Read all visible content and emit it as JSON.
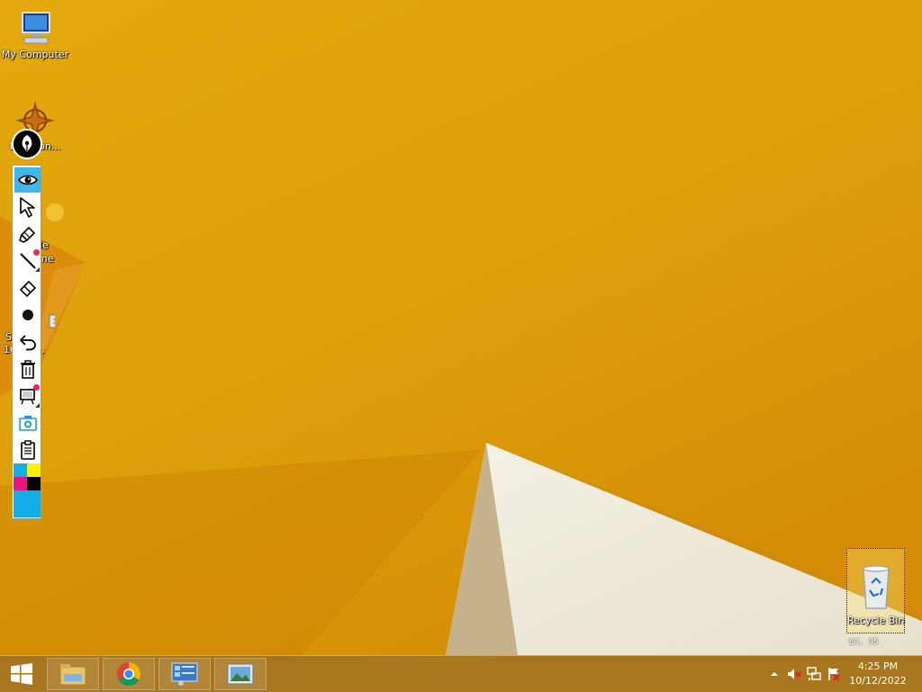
{
  "desktop": {
    "icons": [
      {
        "label": "My Computer",
        "icon": "computer-icon"
      },
      {
        "label": "Dark Dragon...",
        "visible_label": "Da  agon...",
        "icon": "dragon-icon"
      },
      {
        "label": "le\nme",
        "line1": "le",
        "line2": "me",
        "icon": "chrome-shortcut-icon"
      },
      {
        "label": "Shot",
        "line1": "S      Shot",
        "line2": "10   22 ...",
        "icon": "screenshot-file-icon"
      }
    ],
    "recycle_bin": {
      "label": "Recycle Bin",
      "icon": "recycle-bin-icon"
    },
    "cursor_readout": "64, 95"
  },
  "pen_toolbar": {
    "logo": "pen-nib-icon",
    "tools": [
      {
        "name": "view-tool",
        "icon": "eye-icon",
        "active": true
      },
      {
        "name": "select-tool",
        "icon": "arrow-cursor-icon"
      },
      {
        "name": "highlighter-tool",
        "icon": "highlighter-icon",
        "badge": true
      },
      {
        "name": "line-tool",
        "icon": "line-icon",
        "menu": true
      },
      {
        "name": "eraser-tool",
        "icon": "eraser-icon"
      },
      {
        "name": "pen-size-tool",
        "icon": "dot-icon"
      },
      {
        "name": "undo-tool",
        "icon": "undo-icon"
      },
      {
        "name": "delete-tool",
        "icon": "trash-icon"
      },
      {
        "name": "whiteboard-tool",
        "icon": "whiteboard-icon",
        "badge": true,
        "menu": true
      },
      {
        "name": "screenshot-tool",
        "icon": "camera-icon"
      },
      {
        "name": "clipboard-tool",
        "icon": "clipboard-icon"
      }
    ],
    "colors": {
      "cyan": "#12aee8",
      "yellow": "#fff200",
      "magenta": "#e8157f",
      "black": "#000000",
      "selected": "#12aee8"
    },
    "badge_color": "#e8265e",
    "active_color": "#3db8e8"
  },
  "taskbar": {
    "start": "windows-logo-icon",
    "pinned": [
      {
        "name": "file-explorer",
        "icon": "folder-icon"
      },
      {
        "name": "chrome",
        "icon": "chrome-icon"
      },
      {
        "name": "control-panel",
        "icon": "control-panel-icon"
      },
      {
        "name": "image-viewer",
        "icon": "picture-icon"
      }
    ],
    "tray": {
      "icons": [
        "show-hidden-icon",
        "volume-muted-icon",
        "network-icon",
        "action-center-flag-icon"
      ],
      "time": "4:25 PM",
      "date": "10/12/2022"
    }
  }
}
